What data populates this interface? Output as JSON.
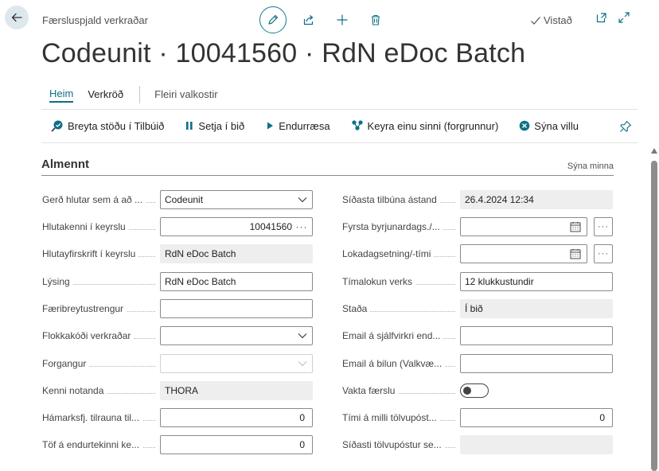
{
  "header": {
    "breadcrumb": "Færsluspjald verkraðar",
    "saved_label": "Vistað",
    "title": "Codeunit · 10041560 · RdN eDoc Batch"
  },
  "tabs": [
    {
      "label": "Heim"
    },
    {
      "label": "Verkröð"
    },
    {
      "label": "Fleiri valkostir"
    }
  ],
  "actions": [
    {
      "label": "Breyta stöðu í Tilbúið",
      "icon": "status-change-icon"
    },
    {
      "label": "Setja í bið",
      "icon": "pause-icon"
    },
    {
      "label": "Endurræsa",
      "icon": "play-icon"
    },
    {
      "label": "Keyra einu sinni (forgrunnur)",
      "icon": "run-once-icon"
    },
    {
      "label": "Sýna villu",
      "icon": "error-icon"
    }
  ],
  "section": {
    "title": "Almennt",
    "show_less": "Sýna minna"
  },
  "left_fields": [
    {
      "label": "Gerð hlutar sem á að ...",
      "value": "Codeunit"
    },
    {
      "label": "Hlutakenni í keyrslu",
      "value": "10041560"
    },
    {
      "label": "Hlutayfirskrift í keyrslu",
      "value": "RdN eDoc Batch"
    },
    {
      "label": "Lýsing",
      "value": "RdN eDoc Batch"
    },
    {
      "label": "Færibreytustrengur",
      "value": ""
    },
    {
      "label": "Flokkakóði verkraðar",
      "value": ""
    },
    {
      "label": "Forgangur",
      "value": ""
    },
    {
      "label": "Kenni notanda",
      "value": "THORA"
    },
    {
      "label": "Hámarksfj. tilrauna til...",
      "value": "0"
    },
    {
      "label": "Töf á endurtekinni ke...",
      "value": "0"
    }
  ],
  "right_fields": [
    {
      "label": "Síðasta tilbúna ástand",
      "value": "26.4.2024 12:34"
    },
    {
      "label": "Fyrsta byrjunardags./...",
      "value": ""
    },
    {
      "label": "Lokadagsetning/-tími",
      "value": ""
    },
    {
      "label": "Tímalokun verks",
      "value": "12 klukkustundir"
    },
    {
      "label": "Staða",
      "value": "Í bið"
    },
    {
      "label": "Email á sjálfvirkri end...",
      "value": ""
    },
    {
      "label": "Email á bilun (Valkvæ...",
      "value": ""
    },
    {
      "label": "Vakta færslu",
      "value": ""
    },
    {
      "label": "Tími á milli tölvupóst...",
      "value": "0"
    },
    {
      "label": "Síðasti tölvupóstur se...",
      "value": ""
    }
  ],
  "colors": {
    "accent": "#0e6f86",
    "readonly_bg": "#eeeeee",
    "border": "#8a8a8a"
  }
}
